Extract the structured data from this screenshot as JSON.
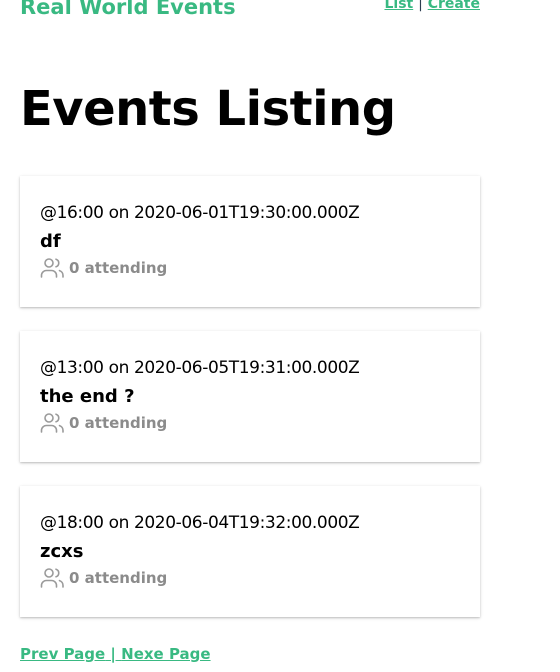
{
  "header": {
    "brand": "Real World Events",
    "links": [
      {
        "label": "List"
      },
      {
        "label": "Create"
      }
    ],
    "separator": "|"
  },
  "page": {
    "title": "Events Listing"
  },
  "events": [
    {
      "time": "@16:00 on 2020-06-01T19:30:00.000Z",
      "title": "df",
      "attending": "0 attending"
    },
    {
      "time": "@13:00 on 2020-06-05T19:31:00.000Z",
      "title": "the end ?",
      "attending": "0 attending"
    },
    {
      "time": "@18:00 on 2020-06-04T19:32:00.000Z",
      "title": "zcxs",
      "attending": "0 attending"
    }
  ],
  "pagination": {
    "prev_label": "Prev Page",
    "separator": " | ",
    "next_label": "Nexe Page"
  },
  "colors": {
    "brand": "#39b982",
    "muted": "#8b8b8b"
  },
  "icons": {
    "attendees": "users-icon"
  }
}
